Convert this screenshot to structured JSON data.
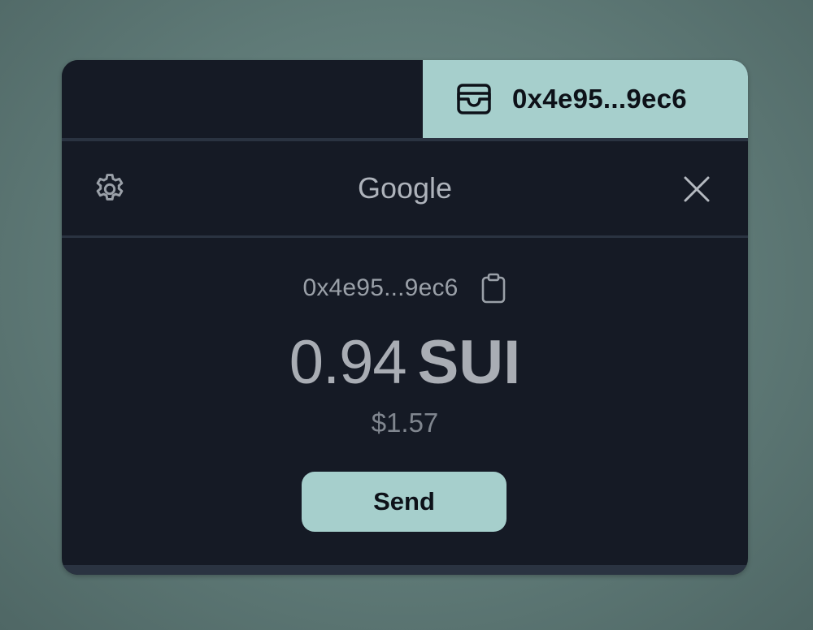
{
  "wallet_tab": {
    "address": "0x4e95...9ec6",
    "icon": "wallet-icon"
  },
  "header": {
    "title": "Google",
    "settings_icon": "gear-icon",
    "close_icon": "close-icon"
  },
  "account": {
    "address": "0x4e95...9ec6",
    "copy_icon": "clipboard-icon",
    "balance_amount": "0.94",
    "balance_unit": "SUI",
    "usd_value": "$1.57"
  },
  "actions": {
    "send_label": "Send"
  },
  "colors": {
    "accent": "#a6cfcc",
    "panel": "#151a25",
    "background": "#5f7a77"
  }
}
